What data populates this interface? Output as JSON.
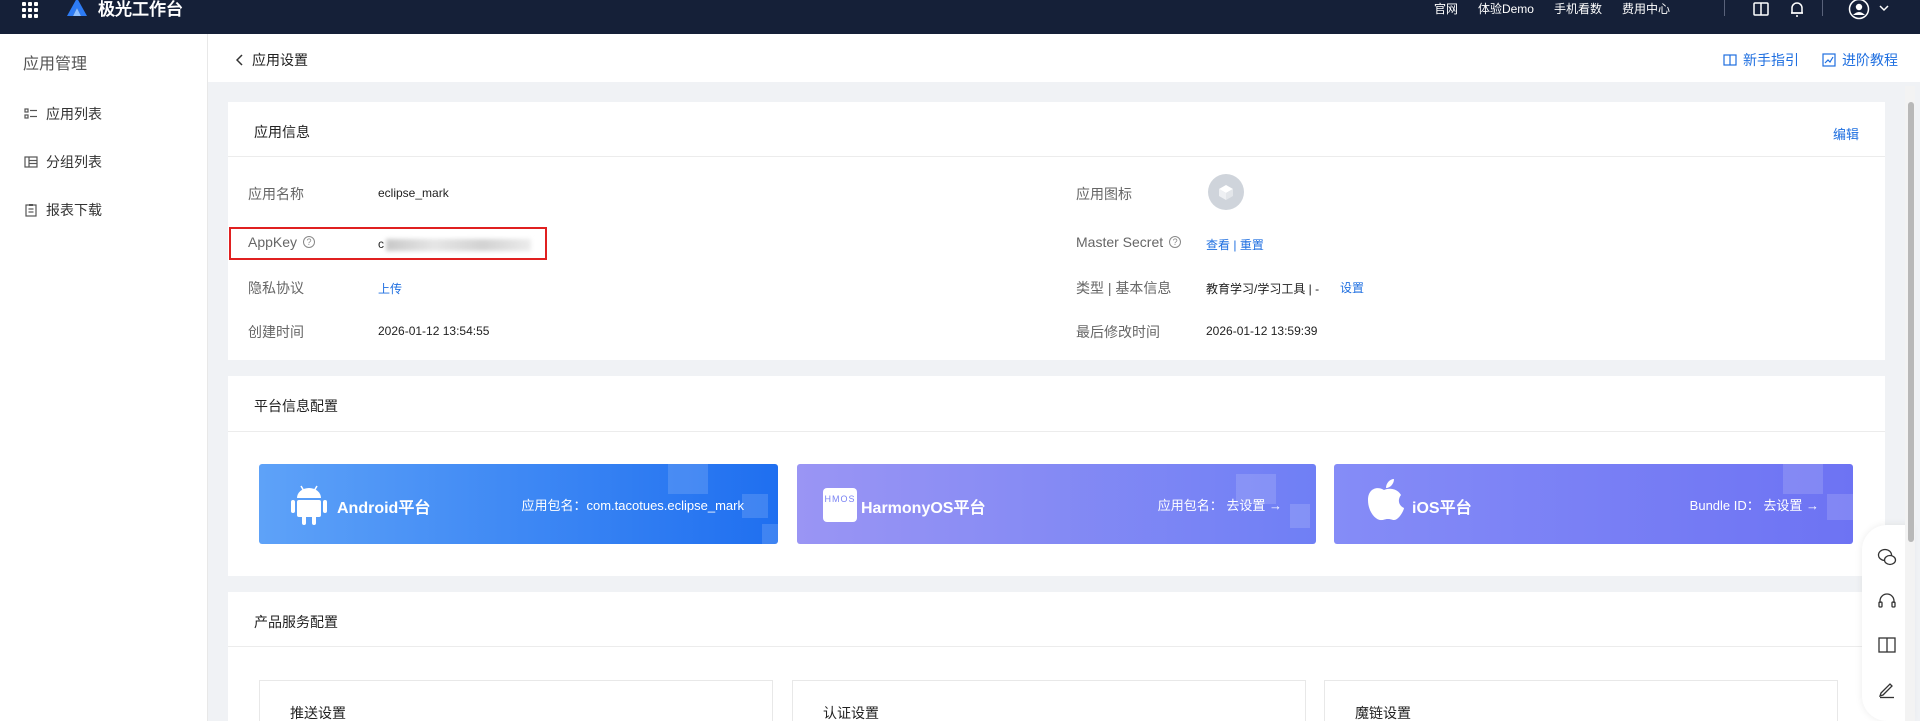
{
  "topbar": {
    "brand": "极光工作台",
    "nav": [
      "官网",
      "体验Demo",
      "手机看数",
      "费用中心"
    ],
    "icons": [
      "apps-grid-icon",
      "book-icon",
      "bell-icon",
      "user-avatar-icon",
      "chevron-down-icon"
    ]
  },
  "sidebar": {
    "title": "应用管理",
    "items": [
      {
        "label": "应用列表",
        "icon": "list-icon"
      },
      {
        "label": "分组列表",
        "icon": "group-table-icon"
      },
      {
        "label": "报表下载",
        "icon": "report-icon"
      }
    ]
  },
  "header": {
    "back_label": "应用设置",
    "guide_label": "新手指引",
    "advanced_label": "进阶教程"
  },
  "app_info": {
    "title": "应用信息",
    "edit_label": "编辑",
    "name_label": "应用名称",
    "name_value": "eclipse_mark",
    "appkey_label": "AppKey",
    "appkey_visible": "c",
    "privacy_label": "隐私协议",
    "privacy_action": "上传",
    "created_label": "创建时间",
    "created_value": "2026-01-12 13:54:55",
    "icon_label": "应用图标",
    "secret_label": "Master Secret",
    "secret_view": "查看",
    "secret_sep": "|",
    "secret_reset": "重置",
    "category_label": "类型 | 基本信息",
    "category_value": "教育学习/学习工具 | -",
    "category_action": "设置",
    "modified_label": "最后修改时间",
    "modified_value": "2026-01-12 13:59:39"
  },
  "platform_config": {
    "title": "平台信息配置",
    "platforms": [
      {
        "name": "Android平台",
        "detail": "应用包名：com.tacotues.eclipse_mark",
        "color_from": "#5ea2f8",
        "color_to": "#1f6ff0"
      },
      {
        "name": "HarmonyOS平台",
        "detail": "应用包名： 去设置 →",
        "color_from": "#8d8df5",
        "color_to": "#6b7cf5"
      },
      {
        "name": "iOS平台",
        "detail": "Bundle ID： 去设置 →",
        "color_from": "#7f86f6",
        "color_to": "#6d73f3"
      }
    ],
    "harmony_logo_text": "HMOS"
  },
  "product_config": {
    "title": "产品服务配置",
    "items": [
      "推送设置",
      "认证设置",
      "魔链设置"
    ]
  },
  "floatbar": {
    "icons": [
      "wechat-icon",
      "headset-icon",
      "book-open-icon",
      "edit-pen-icon"
    ]
  }
}
